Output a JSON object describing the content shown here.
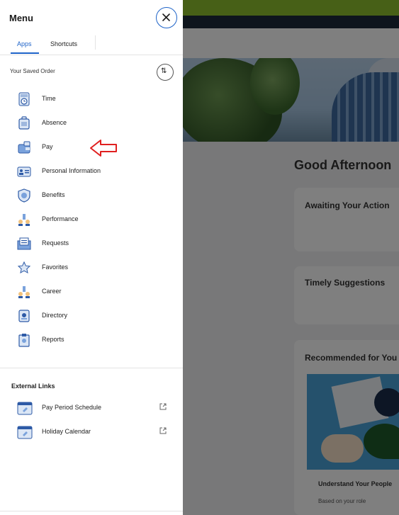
{
  "menu": {
    "title": "Menu",
    "tabs": [
      {
        "label": "Apps",
        "active": true
      },
      {
        "label": "Shortcuts",
        "active": false
      }
    ],
    "saved_order_label": "Your Saved Order",
    "reorder_icon": "sort-arrows-icon",
    "close_icon": "close-icon",
    "apps": [
      {
        "label": "Time",
        "icon": "time-clock-icon"
      },
      {
        "label": "Absence",
        "icon": "absence-suitcase-icon"
      },
      {
        "label": "Pay",
        "icon": "pay-wallet-icon"
      },
      {
        "label": "Personal Information",
        "icon": "personal-id-card-icon"
      },
      {
        "label": "Benefits",
        "icon": "benefits-shield-icon"
      },
      {
        "label": "Performance",
        "icon": "performance-people-icon"
      },
      {
        "label": "Requests",
        "icon": "requests-envelope-icon"
      },
      {
        "label": "Favorites",
        "icon": "favorites-star-icon"
      },
      {
        "label": "Career",
        "icon": "career-people-icon"
      },
      {
        "label": "Directory",
        "icon": "directory-book-icon"
      },
      {
        "label": "Reports",
        "icon": "reports-clipboard-icon"
      }
    ],
    "external_links_title": "External Links",
    "external_links": [
      {
        "label": "Pay Period Schedule",
        "icon": "calendar-icon"
      },
      {
        "label": "Holiday Calendar",
        "icon": "calendar-icon"
      }
    ],
    "colors": {
      "accent": "#1e63c8",
      "annotation_arrow": "#e02020"
    }
  },
  "background": {
    "greeting": "Good Afternoon",
    "cards": [
      {
        "title": "Awaiting Your Action"
      },
      {
        "title": "Timely Suggestions"
      },
      {
        "title": "Recommended for You"
      }
    ],
    "recommendation": {
      "title": "Understand Your People",
      "subtitle": "Based on your role"
    }
  }
}
